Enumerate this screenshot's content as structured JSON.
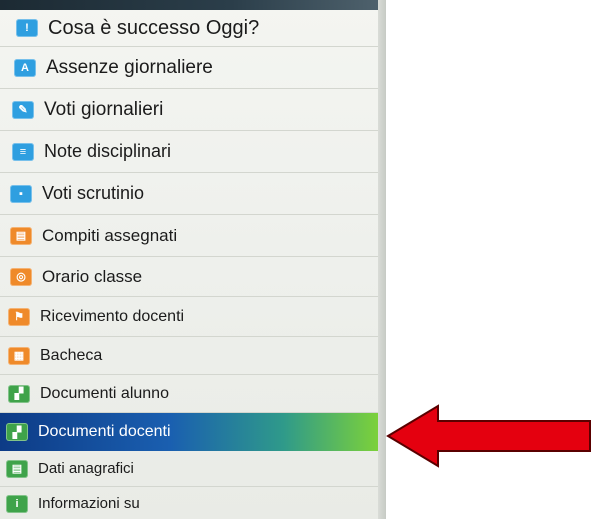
{
  "menu": {
    "items": [
      {
        "label": "Cosa è successo Oggi?",
        "icon": "clock-icon",
        "color": "#2f9fe0",
        "glyph": "!"
      },
      {
        "label": "Assenze giornaliere",
        "icon": "absence-icon",
        "color": "#2f9fe0",
        "glyph": "A"
      },
      {
        "label": "Voti giornalieri",
        "icon": "grades-icon",
        "color": "#2f9fe0",
        "glyph": "✎"
      },
      {
        "label": "Note disciplinari",
        "icon": "notes-icon",
        "color": "#2f9fe0",
        "glyph": "≡"
      },
      {
        "label": "Voti scrutinio",
        "icon": "report-card-icon",
        "color": "#2f9fe0",
        "glyph": "▪"
      },
      {
        "label": "Compiti assegnati",
        "icon": "homework-icon",
        "color": "#ef8a2a",
        "glyph": "▤"
      },
      {
        "label": "Orario classe",
        "icon": "timetable-icon",
        "color": "#ef8a2a",
        "glyph": "◎"
      },
      {
        "label": "Ricevimento docenti",
        "icon": "meeting-icon",
        "color": "#ef8a2a",
        "glyph": "⚑"
      },
      {
        "label": "Bacheca",
        "icon": "board-icon",
        "color": "#ef8a2a",
        "glyph": "▦"
      },
      {
        "label": "Documenti alunno",
        "icon": "student-documents-icon",
        "color": "#3fa34a",
        "glyph": "▞"
      },
      {
        "label": "Documenti docenti",
        "icon": "teacher-documents-icon",
        "color": "#3fa34a",
        "glyph": "▞",
        "selected": true
      },
      {
        "label": "Dati anagrafici",
        "icon": "personal-data-icon",
        "color": "#3fa34a",
        "glyph": "▤"
      },
      {
        "label": "Informazioni su",
        "icon": "info-icon",
        "color": "#3fa34a",
        "glyph": "i"
      }
    ]
  },
  "annotation": {
    "icon": "red-arrow-icon",
    "color": "#e4000f",
    "points_to": "Documenti docenti"
  }
}
